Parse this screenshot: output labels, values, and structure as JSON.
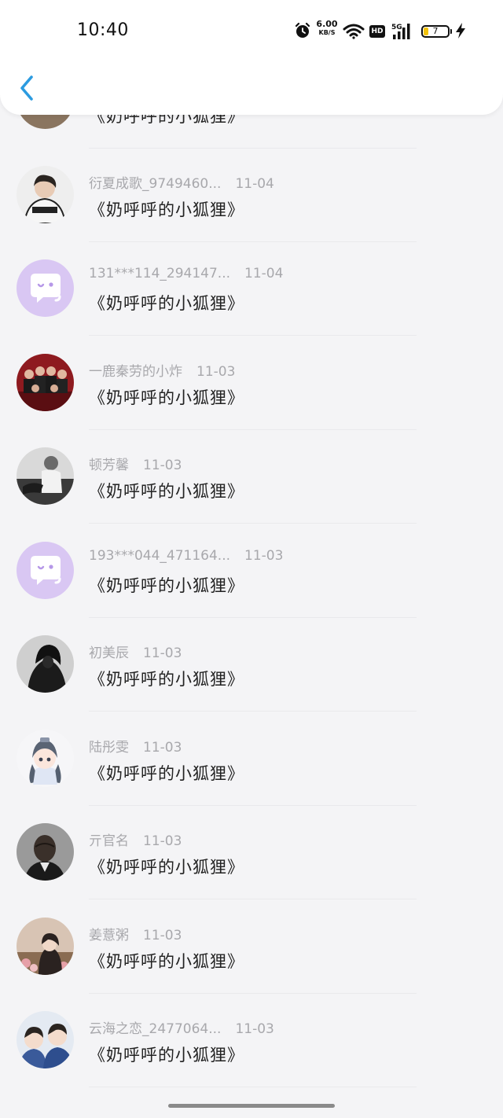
{
  "status_bar": {
    "time": "10:40",
    "net_speed_value": "6.00",
    "net_speed_unit": "KB/S",
    "hd_label": "HD",
    "network_label": "5G",
    "battery_level": "7",
    "icons": [
      "alarm-icon",
      "wifi-icon",
      "signal-icon",
      "battery-icon",
      "charging-bolt-icon"
    ]
  },
  "header": {
    "back_icon": "chevron-left-icon",
    "accent_color": "#2c9be0"
  },
  "list": {
    "partial_top_item": {
      "title": "《奶呼呼的小狐狸》"
    },
    "items": [
      {
        "name": "衍夏成歌_9749460...",
        "date": "11-04",
        "title": "《奶呼呼的小狐狸》",
        "avatar": "photo-boy-jersey"
      },
      {
        "name": "131***114_294147...",
        "date": "11-04",
        "title": "《奶呼呼的小狐狸》",
        "avatar": "default-chat-purple"
      },
      {
        "name": "一鹿秦劳的小炸",
        "date": "11-03",
        "title": "《奶呼呼的小狐狸》",
        "avatar": "photo-group-red"
      },
      {
        "name": "顿芳馨",
        "date": "11-03",
        "title": "《奶呼呼的小狐狸》",
        "avatar": "photo-bw-man"
      },
      {
        "name": "193***044_471164...",
        "date": "11-03",
        "title": "《奶呼呼的小狐狸》",
        "avatar": "default-chat-purple"
      },
      {
        "name": "初美辰",
        "date": "11-03",
        "title": "《奶呼呼的小狐狸》",
        "avatar": "photo-dark-hood"
      },
      {
        "name": "陆彤雯",
        "date": "11-03",
        "title": "《奶呼呼的小狐狸》",
        "avatar": "anime-chibi"
      },
      {
        "name": "亓官名",
        "date": "11-03",
        "title": "《奶呼呼的小狐狸》",
        "avatar": "photo-bald-man"
      },
      {
        "name": "姜薏粥",
        "date": "11-03",
        "title": "《奶呼呼的小狐狸》",
        "avatar": "photo-flowers-girl"
      },
      {
        "name": "云海之恋_2477064...",
        "date": "11-03",
        "title": "《奶呼呼的小狐狸》",
        "avatar": "photo-couple"
      }
    ]
  },
  "colors": {
    "default_avatar_bg": "#d9c7f3",
    "background": "#f4f4f6",
    "meta_text": "#a8a8ac",
    "title_text": "#222222"
  }
}
